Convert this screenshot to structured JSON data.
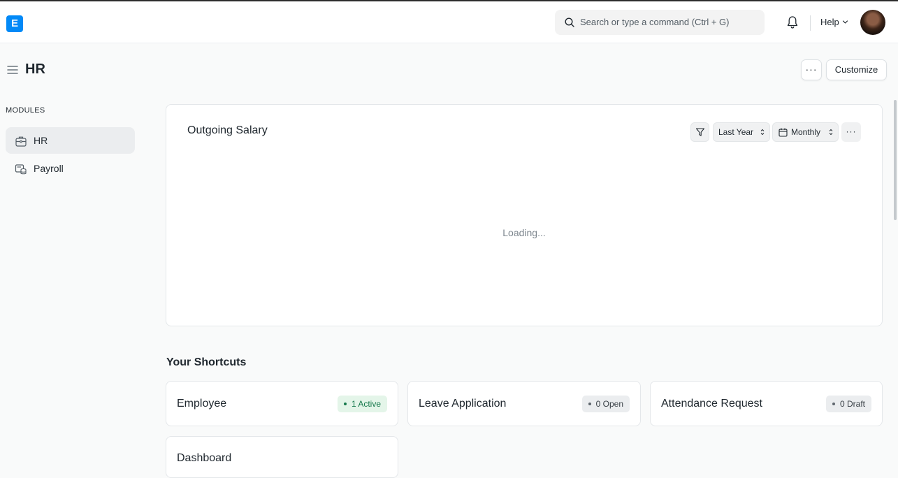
{
  "navbar": {
    "logo_letter": "E",
    "search_placeholder": "Search or type a command (Ctrl + G)",
    "help_label": "Help"
  },
  "page": {
    "title": "HR",
    "more_label": "···",
    "customize_label": "Customize"
  },
  "sidebar": {
    "section_label": "MODULES",
    "items": [
      {
        "label": "HR",
        "icon": "briefcase-icon",
        "active": true
      },
      {
        "label": "Payroll",
        "icon": "payroll-icon",
        "active": false
      }
    ]
  },
  "chart_card": {
    "title": "Outgoing Salary",
    "period_label": "Last Year",
    "interval_label": "Monthly",
    "more_label": "···",
    "loading_text": "Loading..."
  },
  "shortcuts": {
    "title": "Your Shortcuts",
    "items": [
      {
        "label": "Employee",
        "badge": "1 Active",
        "badge_color": "green"
      },
      {
        "label": "Leave Application",
        "badge": "0 Open",
        "badge_color": "gray"
      },
      {
        "label": "Attendance Request",
        "badge": "0 Draft",
        "badge_color": "gray"
      },
      {
        "label": "Dashboard",
        "badge": "",
        "badge_color": ""
      }
    ]
  },
  "colors": {
    "accent": "#0289f7",
    "background": "#f9fafa",
    "active_badge_bg": "#e4f5e9",
    "active_badge_text": "#16794c"
  }
}
